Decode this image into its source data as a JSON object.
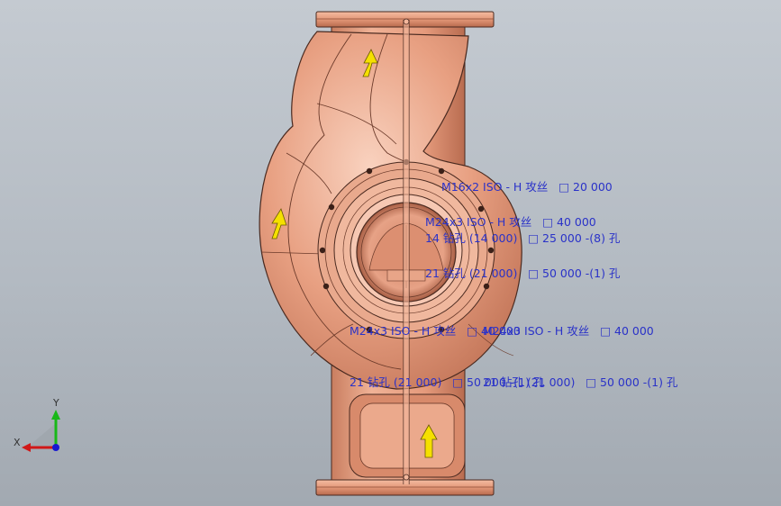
{
  "colors": {
    "part_fill": "#e59a7c",
    "part_light": "#f7c7b0",
    "part_dark": "#b86a4e",
    "edge": "#4a2a20",
    "annotation_text": "#2a32c8",
    "arrow_fill": "#f5e000",
    "axis_x": "#d01818",
    "axis_y": "#18b818",
    "axis_z": "#1818d0"
  },
  "annotations": [
    {
      "line1": "M16x2 ISO - H 攻丝   □ 20 000",
      "line2": "14 钻孔 (14 000)   □ 25 000 -(8) 孔"
    },
    {
      "line1": "M24x3 ISO - H 攻丝   □ 40 000",
      "line2": "21 钻孔 (21 000)   □ 50 000 -(1) 孔"
    },
    {
      "line1": "M24x3 ISO - H 攻丝   □ 40 000",
      "line2": "21 钻孔 (21 000)   □ 50 000 -(1) 孔"
    },
    {
      "line1": "M24x3 ISO - H 攻丝   □ 40 000",
      "line2": "21 钻孔 (21 000)   □ 50 000 -(1) 孔"
    }
  ],
  "triad": {
    "x_label": "X",
    "y_label": "Y"
  },
  "icons": {
    "flow_arrow": "flow-arrow-icon",
    "triad": "coordinate-triad-icon"
  }
}
